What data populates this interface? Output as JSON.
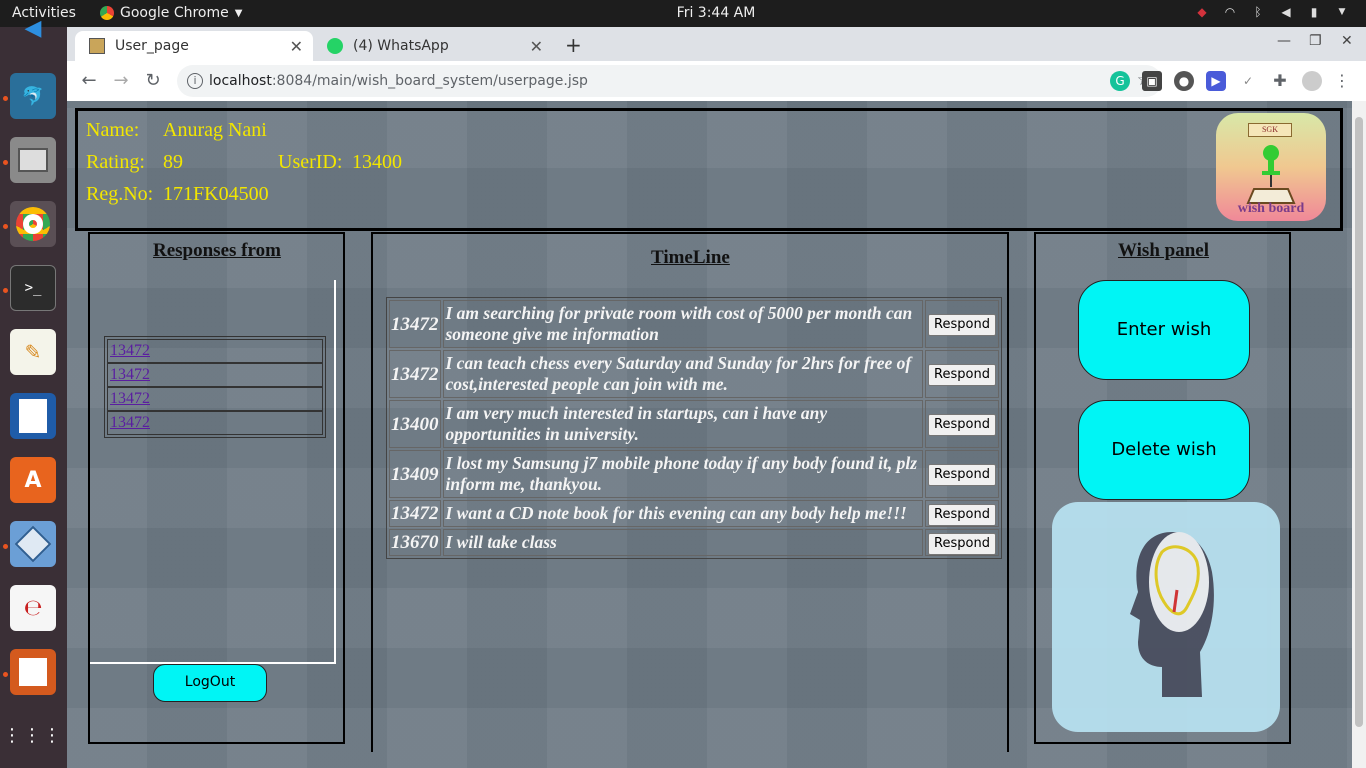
{
  "topbar": {
    "activities": "Activities",
    "app_name": "Google Chrome",
    "clock": "Fri  3:44 AM"
  },
  "chrome": {
    "tabs": [
      {
        "label": "User_page",
        "active": true
      },
      {
        "label": "(4) WhatsApp",
        "active": false
      }
    ],
    "url_host": "localhost",
    "url_rest": ":8084/main/wish_board_system/userpage.jsp"
  },
  "header": {
    "name_label": "Name:",
    "name_value": "Anurag Nani",
    "rating_label": "Rating:",
    "rating_value": "89",
    "userid_label": "UserID:",
    "userid_value": "13400",
    "regno_label": "Reg.No:",
    "regno_value": "171FK04500",
    "logo_sign": "SGK",
    "logo_text": "wish board"
  },
  "responses": {
    "title": "Responses from",
    "items": [
      "13472",
      "13472",
      "13472",
      "13472"
    ],
    "logout_label": "LogOut"
  },
  "timeline": {
    "title": "TimeLine",
    "respond_label": "Respond",
    "rows": [
      {
        "uid": "13472",
        "msg": "I am searching for private room with cost of 5000 per month can someone give me information"
      },
      {
        "uid": "13472",
        "msg": "I can teach chess every Saturday and Sunday for 2hrs for free of cost,interested people can join with me."
      },
      {
        "uid": "13400",
        "msg": "I am very much interested in startups, can i have any opportunities in university."
      },
      {
        "uid": "13409",
        "msg": "I lost my Samsung j7 mobile phone today if any body found it, plz inform me, thankyou."
      },
      {
        "uid": "13472",
        "msg": "I want a CD note book for this evening can any body help me!!!"
      },
      {
        "uid": "13670",
        "msg": "I will take class"
      }
    ]
  },
  "wish_panel": {
    "title": "Wish panel",
    "enter_label": "Enter wish",
    "delete_label": "Delete wish"
  },
  "colors": {
    "accent_cyan": "#00f5f5",
    "header_text": "#f2e600"
  }
}
